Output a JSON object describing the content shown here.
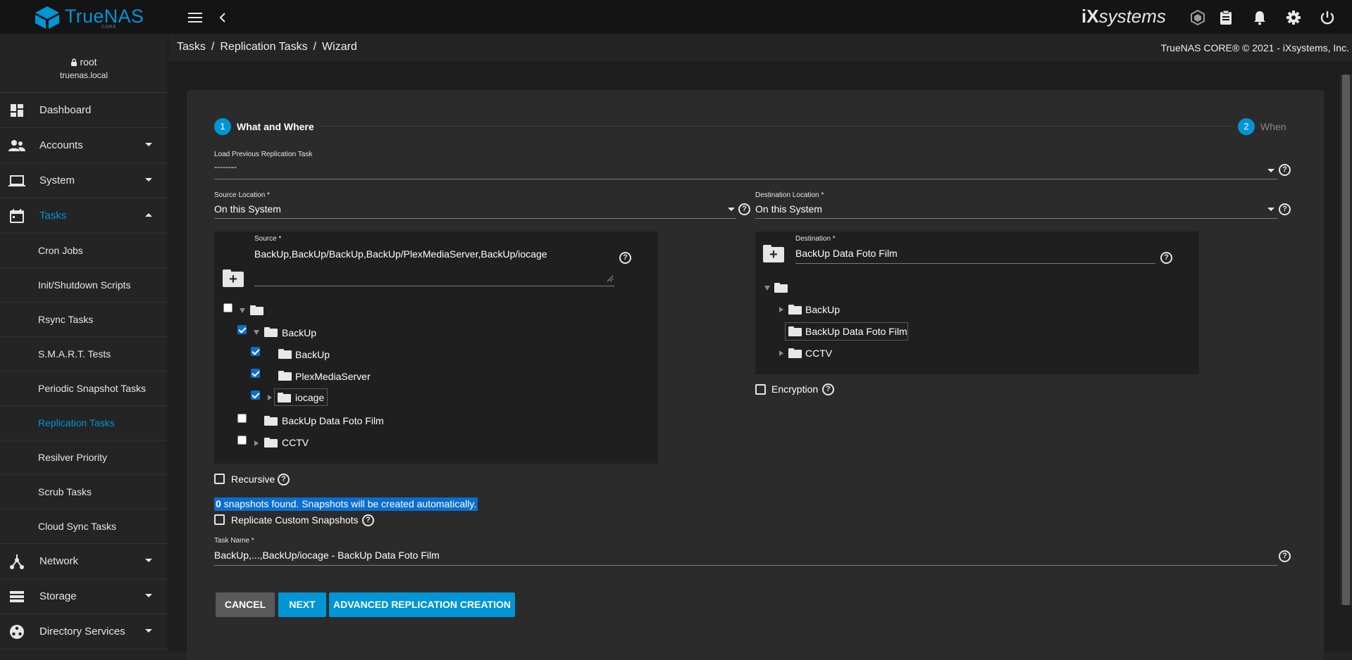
{
  "topbar": {
    "brand": "TrueNAS",
    "brand_sub": "CORE",
    "vendor_logo_i": "iX",
    "vendor_logo_text": "systems",
    "icons": [
      "menu-icon",
      "back-icon",
      "truecommand-icon",
      "clipboard-icon",
      "bell-icon",
      "gear-icon",
      "power-icon"
    ]
  },
  "user": {
    "name": "root",
    "host": "truenas.local"
  },
  "sidebar": {
    "items": [
      {
        "label": "Dashboard",
        "icon": "dashboard-icon"
      },
      {
        "label": "Accounts",
        "icon": "people-icon"
      },
      {
        "label": "System",
        "icon": "laptop-icon"
      },
      {
        "label": "Tasks",
        "icon": "calendar-icon"
      },
      {
        "label": "Network",
        "icon": "network-icon"
      },
      {
        "label": "Storage",
        "icon": "storage-icon"
      },
      {
        "label": "Directory Services",
        "icon": "directory-icon"
      }
    ],
    "task_subitems": [
      "Cron Jobs",
      "Init/Shutdown Scripts",
      "Rsync Tasks",
      "S.M.A.R.T. Tests",
      "Periodic Snapshot Tasks",
      "Replication Tasks",
      "Resilver Priority",
      "Scrub Tasks",
      "Cloud Sync Tasks"
    ]
  },
  "breadcrumb": [
    "Tasks",
    "Replication Tasks",
    "Wizard"
  ],
  "breadcrumb_sep": "/",
  "copyright": "TrueNAS CORE® © 2021 - iXsystems, Inc.",
  "wizard": {
    "steps": [
      {
        "num": "1",
        "label": "What and Where"
      },
      {
        "num": "2",
        "label": "When"
      }
    ],
    "load_previous": {
      "label": "Load Previous Replication Task",
      "value": "--------"
    },
    "source_location": {
      "label": "Source Location *",
      "value": "On this System"
    },
    "destination_location": {
      "label": "Destination Location *",
      "value": "On this System"
    },
    "source": {
      "label": "Source *",
      "value": "BackUp,BackUp/BackUp,BackUp/PlexMediaServer,BackUp/iocage",
      "tree": [
        "BackUp",
        "BackUp",
        "PlexMediaServer",
        "iocage",
        "BackUp Data Foto Film",
        "CCTV"
      ]
    },
    "destination": {
      "label": "Destination *",
      "value": "BackUp Data Foto Film",
      "tree": [
        "BackUp",
        "BackUp Data Foto Film",
        "CCTV"
      ]
    },
    "encryption_label": "Encryption",
    "recursive_label": "Recursive",
    "snapshots": {
      "count": "0",
      "text": " snapshots found. Snapshots will be created automatically."
    },
    "replicate_custom_label": "Replicate Custom Snapshots",
    "task_name": {
      "label": "Task Name *",
      "value": "BackUp,...,BackUp/iocage - BackUp Data Foto Film"
    },
    "buttons": {
      "cancel": "CANCEL",
      "next": "NEXT",
      "advanced": "ADVANCED REPLICATION CREATION"
    },
    "help_glyph": "?"
  },
  "colors": {
    "accent": "#0095d5",
    "selected": "#0a6ed1",
    "topbar": "#141414",
    "card": "#2b2b2b",
    "panel": "#1f1f1f"
  }
}
